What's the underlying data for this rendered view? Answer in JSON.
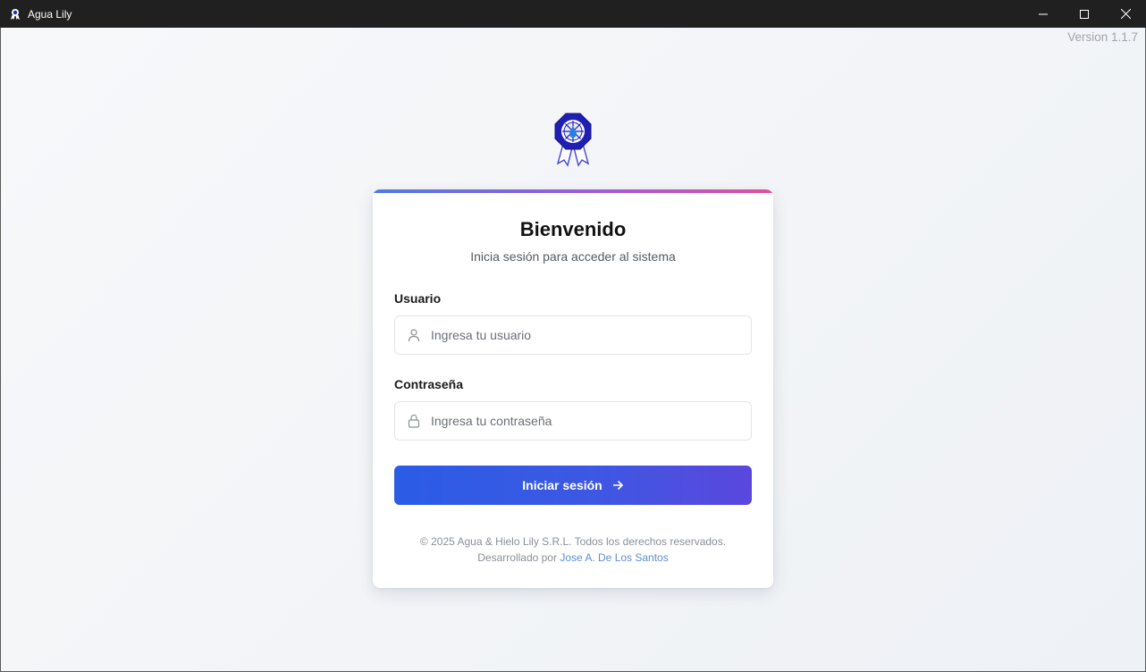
{
  "window": {
    "title": "Agua Lily",
    "icon": "agua-lily-app-icon",
    "controls": [
      "minimize-icon",
      "maximize-icon",
      "close-icon"
    ]
  },
  "app": {
    "version": "Version 1.1.7",
    "logo": "agua-lily-badge-logo"
  },
  "login": {
    "title": "Bienvenido",
    "subtitle": "Inicia sesión para acceder al sistema",
    "username": {
      "label": "Usuario",
      "placeholder": "Ingresa tu usuario",
      "value": "",
      "icon": "user-icon"
    },
    "password": {
      "label": "Contraseña",
      "placeholder": "Ingresa tu contraseña",
      "value": "",
      "icon": "lock-icon"
    },
    "submit_label": "Iniciar sesión",
    "submit_icon": "arrow-right-icon"
  },
  "footer": {
    "copyright": "© 2025 Agua & Hielo Lily S.R.L. Todos los derechos reservados.",
    "developed_by": "Desarrollado por",
    "developer_name": "Jose A. De Los Santos"
  },
  "colors": {
    "accent_gradient_start": "#2a5ce6",
    "accent_gradient_end": "#5a47dd",
    "top_bar_start": "#4f7ae0",
    "top_bar_end": "#e0509a",
    "link": "#5b8fd6",
    "logo_blue": "#1f1fb3"
  }
}
